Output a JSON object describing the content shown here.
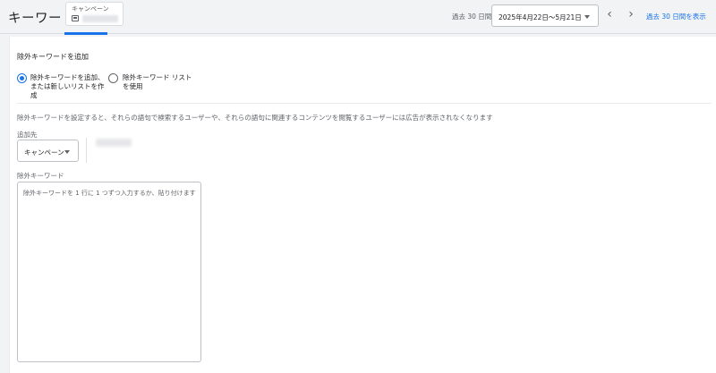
{
  "header": {
    "title": "キーワード",
    "campaign_label": "キャンペーン",
    "period_label": "過去 30 日間",
    "date_range": "2025年4月22日〜5月21日",
    "prev_symbol": "‹",
    "next_symbol": "›",
    "show_last_30": "過去 30 日間を表示"
  },
  "form": {
    "section_title": "除外キーワードを追加",
    "options": [
      {
        "label_line1": "除外キーワードを追加、",
        "label_line2": "または新しいリストを作",
        "label_line3": "成",
        "selected": true
      },
      {
        "label_line1": "除外キーワード リスト",
        "label_line2": "を使用",
        "selected": false
      }
    ],
    "description": "除外キーワードを設定すると、それらの語句で検索するユーザーや、それらの語句に関連するコンテンツを閲覧するユーザーには広告が表示されなくなります",
    "destination_label": "追加先",
    "destination_value": "キャンペーン",
    "keywords_label": "除外キーワード",
    "keywords_placeholder": "除外キーワードを 1 行に 1 つずつ入力するか、貼り付けます"
  },
  "colors": {
    "accent": "#1a73e8",
    "background": "#f1f3f4"
  },
  "icons": {
    "campaign": "campaign-icon",
    "dropdown": "chevron-down-icon",
    "prev": "chevron-left-icon",
    "next": "chevron-right-icon"
  }
}
